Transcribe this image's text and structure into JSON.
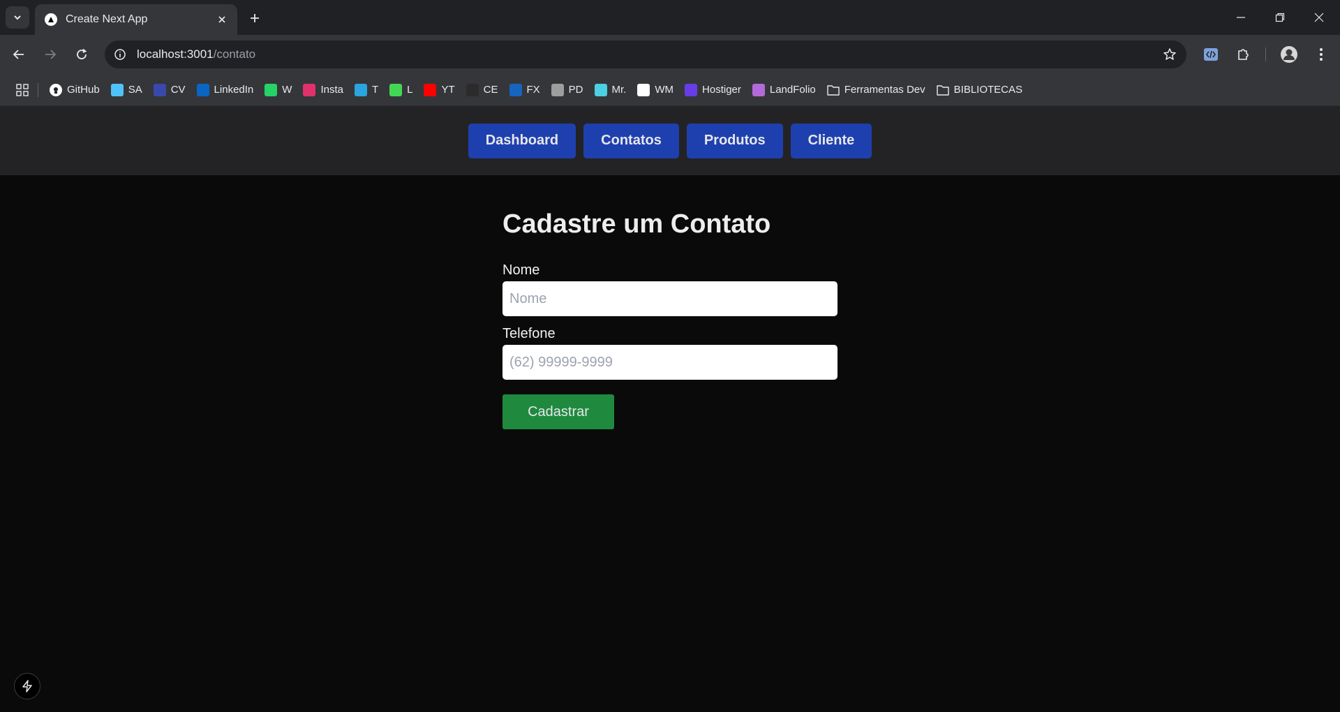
{
  "browser": {
    "tab_title": "Create Next App",
    "url_host": "localhost:3001",
    "url_path": "/contato",
    "bookmarks": [
      {
        "label": "GitHub",
        "icon": "github-icon",
        "color": "#ffffff"
      },
      {
        "label": "SA",
        "icon": "diamond-icon",
        "color": "#4fc3f7"
      },
      {
        "label": "CV",
        "icon": "cv-icon",
        "color": "#3949ab"
      },
      {
        "label": "LinkedIn",
        "icon": "linkedin-icon",
        "color": "#0a66c2"
      },
      {
        "label": "W",
        "icon": "whatsapp-icon",
        "color": "#25d366"
      },
      {
        "label": "Insta",
        "icon": "instagram-icon",
        "color": "#e1306c"
      },
      {
        "label": "T",
        "icon": "telegram-icon",
        "color": "#2aa5e0"
      },
      {
        "label": "L",
        "icon": "asterisk-icon",
        "color": "#43d854"
      },
      {
        "label": "YT",
        "icon": "youtube-icon",
        "color": "#ff0000"
      },
      {
        "label": "CE",
        "icon": "inv-icon",
        "color": "#2b2b2b"
      },
      {
        "label": "FX",
        "icon": "paypal-icon",
        "color": "#1565c0"
      },
      {
        "label": "PD",
        "icon": "document-icon",
        "color": "#9e9e9e"
      },
      {
        "label": "Mr.",
        "icon": "gear-flower-icon",
        "color": "#4dd0e1"
      },
      {
        "label": "WM",
        "icon": "w-logo-icon",
        "color": "#ffffff"
      },
      {
        "label": "Hostiger",
        "icon": "hostinger-icon",
        "color": "#673de6"
      },
      {
        "label": "LandFolio",
        "icon": "boot-icon",
        "color": "#b36ad9"
      },
      {
        "label": "Ferramentas Dev",
        "icon": "folder-icon",
        "color": "#e8eaed"
      },
      {
        "label": "BIBLIOTECAS",
        "icon": "folder-icon",
        "color": "#e8eaed"
      }
    ]
  },
  "app": {
    "nav": [
      "Dashboard",
      "Contatos",
      "Produtos",
      "Cliente"
    ],
    "form": {
      "title": "Cadastre um Contato",
      "name_label": "Nome",
      "name_placeholder": "Nome",
      "phone_label": "Telefone",
      "phone_placeholder": "(62) 99999-9999",
      "submit_label": "Cadastrar"
    }
  },
  "colors": {
    "nav_button": "#1e40af",
    "submit_button": "#1f8a3e",
    "page_background": "#0a0a0a"
  }
}
